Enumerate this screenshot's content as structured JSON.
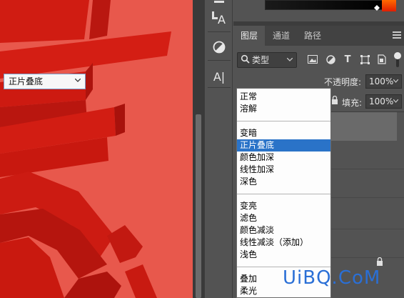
{
  "canvas": {
    "background_color": "#e8584c",
    "stroke_color": "#c8150f"
  },
  "tools": [
    {
      "name": "type-on-path-tool",
      "icon": "type-vertical-icon",
      "glyph": "A"
    },
    {
      "name": "adjustment-tool",
      "icon": "adjustment-circle-icon"
    },
    {
      "name": "character-tool",
      "icon": "text-cursor-icon",
      "glyph": "A|"
    }
  ],
  "layers_panel": {
    "tabs": [
      {
        "label": "图层",
        "active": true
      },
      {
        "label": "通道",
        "active": false
      },
      {
        "label": "路径",
        "active": false
      }
    ],
    "filter": {
      "value": "类型",
      "icons": [
        "image-filter-icon",
        "adjustment-filter-icon",
        "type-filter-icon",
        "shape-filter-icon",
        "smart-object-filter-icon"
      ],
      "type_glyph": "T"
    },
    "blend_mode": {
      "value": "正片叠底",
      "options_groups": [
        [
          "正常",
          "溶解"
        ],
        [
          "变暗",
          "正片叠底",
          "颜色加深",
          "线性加深",
          "深色"
        ],
        [
          "变亮",
          "滤色",
          "颜色减淡",
          "线性减淡（添加）",
          "浅色"
        ],
        [
          "叠加",
          "柔光"
        ]
      ],
      "selected": "正片叠底"
    },
    "opacity": {
      "label": "不透明度:",
      "value": "100%"
    },
    "fill": {
      "label": "填充:",
      "value": "100%"
    }
  },
  "colors": {
    "accent": "#2a73c8",
    "panel_bg": "#535353",
    "watermark": "#2a6fd6"
  },
  "watermark": {
    "text": "UiBQ.CoM"
  }
}
